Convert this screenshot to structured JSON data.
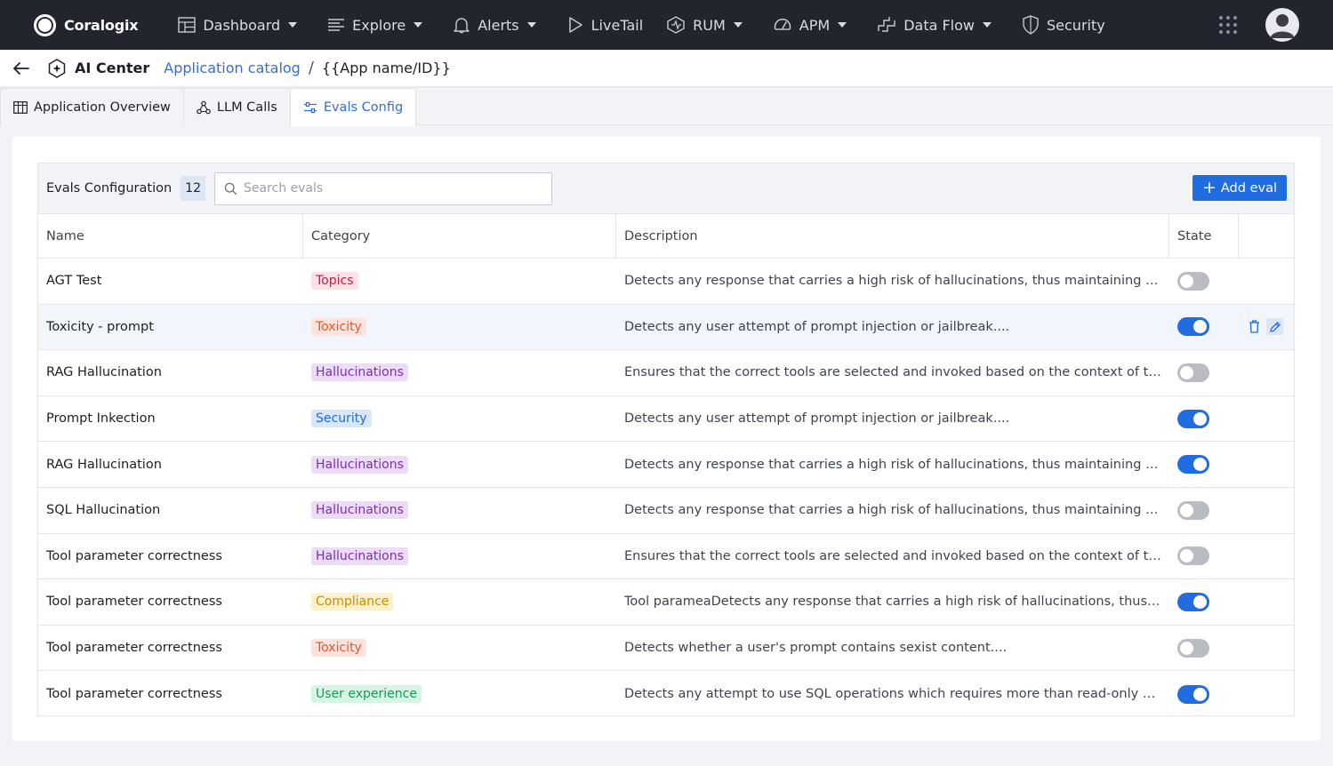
{
  "brand": {
    "name": "Coralogix"
  },
  "nav": {
    "items": [
      {
        "label": "Dashboard",
        "icon": "dashboard-icon",
        "dropdown": true
      },
      {
        "label": "Explore",
        "icon": "explore-icon",
        "dropdown": true
      },
      {
        "label": "Alerts",
        "icon": "bell-icon",
        "dropdown": true
      },
      {
        "label": "LiveTail",
        "icon": "play-icon",
        "dropdown": false
      },
      {
        "label": "RUM",
        "icon": "rum-icon",
        "dropdown": true
      },
      {
        "label": "APM",
        "icon": "gauge-icon",
        "dropdown": true
      },
      {
        "label": "Data Flow",
        "icon": "dataflow-icon",
        "dropdown": true
      },
      {
        "label": "Security",
        "icon": "shield-icon",
        "dropdown": false
      }
    ]
  },
  "breadcrumb": {
    "app": "AI Center",
    "link": "Application catalog",
    "separator": "/",
    "current": "{{App name/ID}}"
  },
  "tabs": [
    {
      "label": "Application Overview",
      "active": false
    },
    {
      "label": "LLM Calls",
      "active": false
    },
    {
      "label": "Evals Config",
      "active": true
    }
  ],
  "toolbar": {
    "title": "Evals Configuration",
    "count": "12",
    "search_placeholder": "Search evals",
    "add_label": "Add eval"
  },
  "columns": {
    "name": "Name",
    "category": "Category",
    "description": "Description",
    "state": "State"
  },
  "category_colors": {
    "Topics": {
      "bg": "#fde1e6",
      "fg": "#c8174a"
    },
    "Toxicity": {
      "bg": "#fde3dc",
      "fg": "#e2562e"
    },
    "Hallucinations": {
      "bg": "#ecdcf7",
      "fg": "#7b2fb0"
    },
    "Security": {
      "bg": "#d9e7fb",
      "fg": "#1f6de0"
    },
    "Compliance": {
      "bg": "#fdf1cc",
      "fg": "#c98d00"
    },
    "User experience": {
      "bg": "#d6f5e4",
      "fg": "#1c9656"
    }
  },
  "rows": [
    {
      "name": "AGT Test",
      "category": "Topics",
      "description": "Detects any response that carries a high risk of hallucinations, thus maintaining the integrity of the output",
      "enabled": false,
      "highlighted": false
    },
    {
      "name": "Toxicity - prompt",
      "category": "Toxicity",
      "description": "Detects any user attempt of prompt injection or jailbreak....",
      "enabled": true,
      "highlighted": true
    },
    {
      "name": "RAG Hallucination",
      "category": "Hallucinations",
      "description": "Ensures that the correct tools are selected and invoked based on the context of the conversation",
      "enabled": false,
      "highlighted": false
    },
    {
      "name": "Prompt Inkection",
      "category": "Security",
      "description": "Detects any user attempt of prompt injection or jailbreak....",
      "enabled": true,
      "highlighted": false
    },
    {
      "name": "RAG Hallucination",
      "category": "Hallucinations",
      "description": "Detects any response that carries a high risk of hallucinations, thus maintaining the integrity of the output",
      "enabled": true,
      "highlighted": false
    },
    {
      "name": "SQL Hallucination",
      "category": "Hallucinations",
      "description": "Detects any response that carries a high risk of hallucinations, thus maintaining the integrity of the output",
      "enabled": false,
      "highlighted": false
    },
    {
      "name": "Tool parameter correctness",
      "category": "Hallucinations",
      "description": "Ensures that the correct tools are selected and invoked based on the context of the conversation",
      "enabled": false,
      "highlighted": false
    },
    {
      "name": "Tool parameter correctness",
      "category": "Compliance",
      "description": "Tool parameaDetects any response that carries a high risk of hallucinations, thus maintaining the integrity",
      "enabled": true,
      "highlighted": false
    },
    {
      "name": "Tool parameter correctness",
      "category": "Toxicity",
      "description": "Detects whether a user's prompt contains sexist content....",
      "enabled": false,
      "highlighted": false
    },
    {
      "name": "Tool parameter correctness",
      "category": "User experience",
      "description": "Detects any attempt to use SQL operations which requires more than read-only access",
      "enabled": true,
      "highlighted": false
    }
  ]
}
